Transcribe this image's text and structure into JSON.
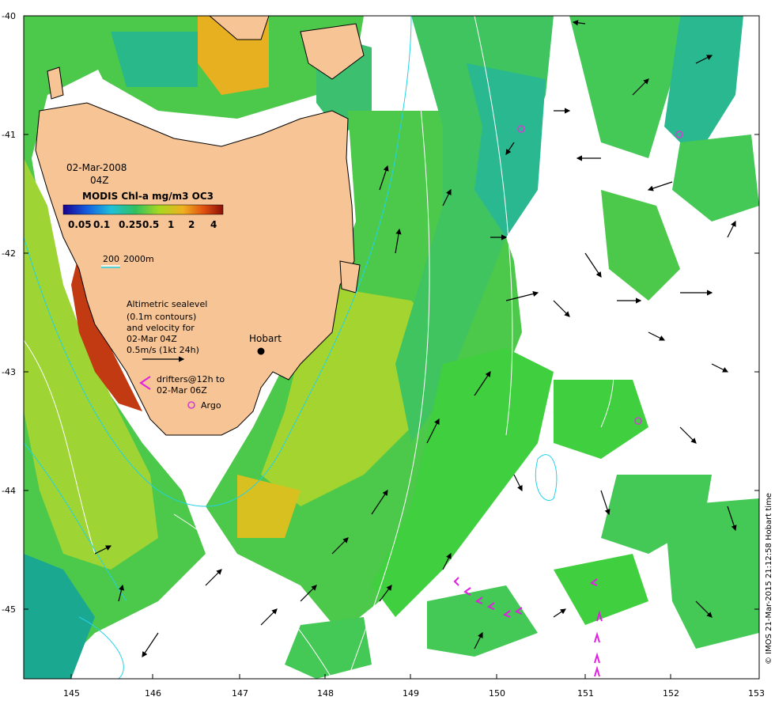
{
  "map": {
    "date_line": "02-Mar-2008",
    "time_line": "04Z",
    "colorbar_title": "MODIS Chl-a mg/m3 OC3",
    "colorbar_ticks": [
      "0.05",
      "0.1",
      "0.25",
      "0.5",
      "1",
      "2",
      "4"
    ],
    "depth_legend": [
      "200",
      "2000m"
    ],
    "sealevel_text": [
      "Altimetric sealevel",
      "(0.1m contours)",
      "and velocity for",
      "02-Mar 04Z",
      "0.5m/s (1kt 24h)"
    ],
    "drifter_text": [
      "drifters@12h to",
      "02-Mar 06Z"
    ],
    "argo_label": "Argo",
    "city_label": "Hobart",
    "credit": "© IMOS 21-Mar-2015 21:12:58 Hobart time",
    "lat_ticks": [
      "-40",
      "-41",
      "-42",
      "-43",
      "-44",
      "-45"
    ],
    "lon_ticks": [
      "145",
      "146",
      "147",
      "148",
      "149",
      "150",
      "151",
      "152",
      "153"
    ],
    "colors": {
      "land": "#f7c495",
      "chl_low": "#1cb39a",
      "chl_mid": "#3fcf3f",
      "chl_high": "#e8d21e",
      "chl_very_high": "#c33a12",
      "isobath": "#22d3e6",
      "sealevel_contour": "#ffffff",
      "drifter": "#e020e0",
      "argo": "#d040d0"
    }
  }
}
